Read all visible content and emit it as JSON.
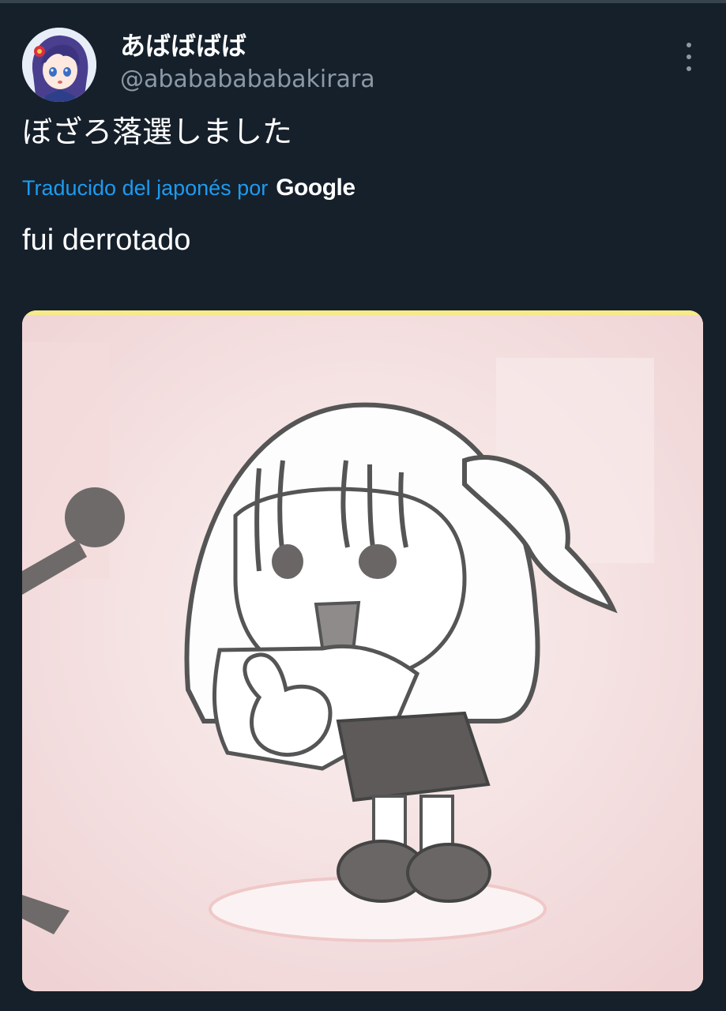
{
  "tweet": {
    "display_name": "あばばばば",
    "handle": "@abababababakirara",
    "text": "ぼざろ落選しました",
    "translation": {
      "label": "Traducido del japonés por",
      "provider": "Google",
      "text": "fui derrotado"
    }
  },
  "colors": {
    "background": "#15202b",
    "link": "#1d9bf0",
    "muted": "#8b98a5"
  }
}
